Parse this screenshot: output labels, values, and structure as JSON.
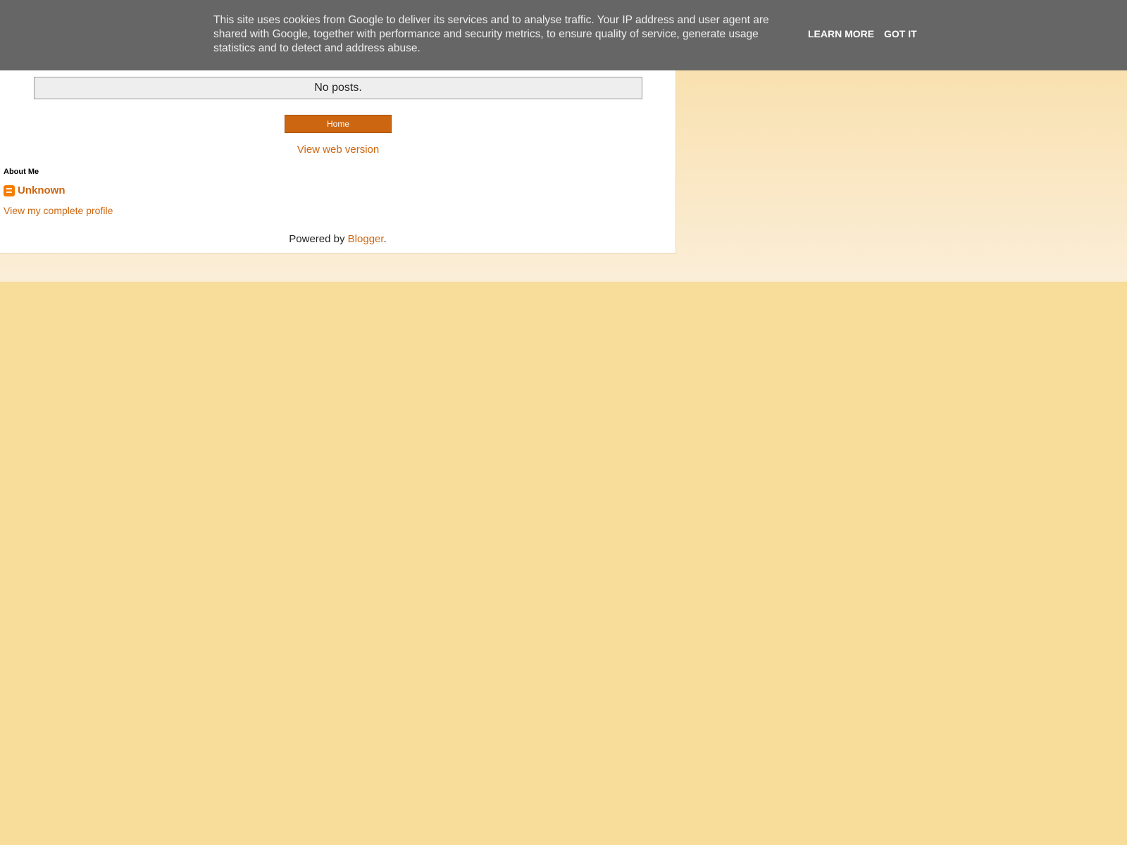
{
  "cookie_notice": {
    "message": "This site uses cookies from Google to deliver its services and to analyse traffic. Your IP address and user agent are shared with Google, together with performance and security metrics, to ensure quality of service, generate usage statistics and to detect and address abuse.",
    "learn_more_label": "LEARN MORE",
    "got_it_label": "GOT IT",
    "background_color": "#666666"
  },
  "posts": {
    "empty_message": "No posts."
  },
  "navigation": {
    "home_label": "Home",
    "web_version_label": "View web version"
  },
  "about": {
    "heading": "About Me",
    "profile_icon": "blogger-icon",
    "name": "Unknown",
    "profile_link_label": "View my complete profile"
  },
  "footer": {
    "powered_by_prefix": "Powered by ",
    "blogger_label": "Blogger",
    "suffix": "."
  },
  "colors": {
    "accent": "#cc6611",
    "page_background": "#f7dc9a"
  }
}
